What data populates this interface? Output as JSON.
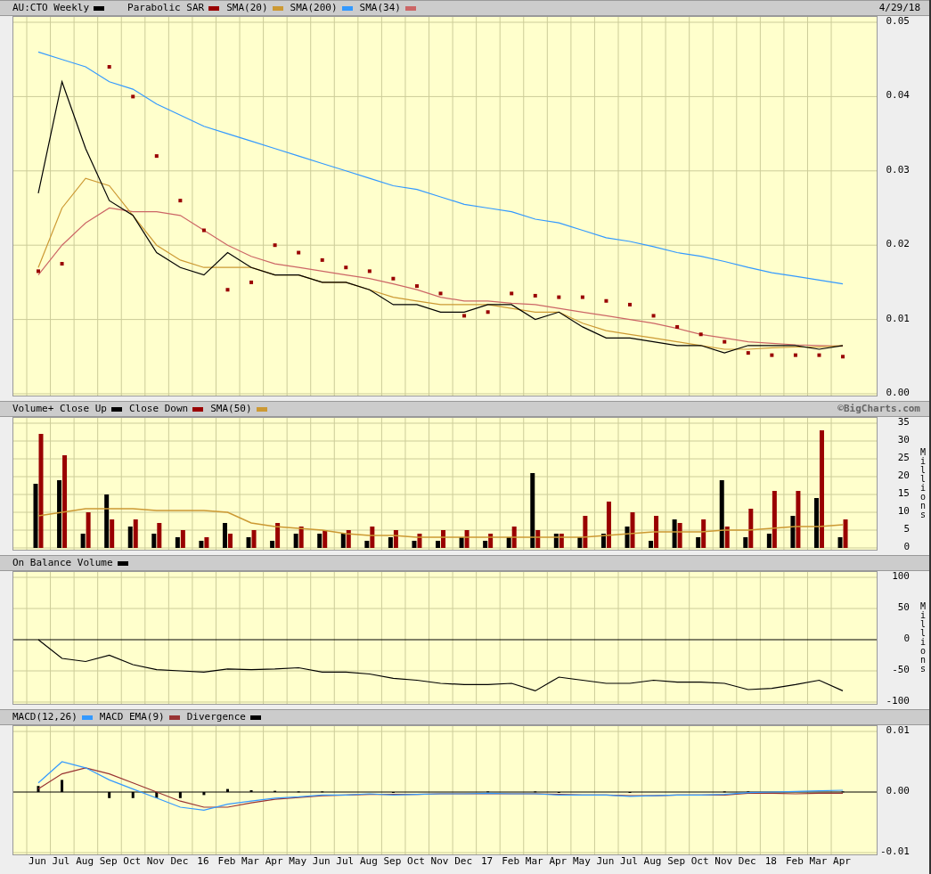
{
  "panels": [
    {
      "kind": "price",
      "date": "4/29/18",
      "chart_data": {
        "type": "line",
        "grid": true,
        "ylim": [
          0,
          0.05
        ],
        "yticks": [
          {
            "value": 0,
            "label": "0.00"
          },
          {
            "value": 0.01,
            "label": "0.01"
          },
          {
            "value": 0.02,
            "label": "0.02"
          },
          {
            "value": 0.03,
            "label": "0.03"
          },
          {
            "value": 0.04,
            "label": "0.04"
          },
          {
            "value": 0.05,
            "label": "0.05"
          }
        ],
        "series": [
          {
            "name": "AU:CTO Weekly",
            "type": "line",
            "color": "#000000",
            "values": [
              0.027,
              0.042,
              0.033,
              0.026,
              0.024,
              0.019,
              0.017,
              0.016,
              0.019,
              0.017,
              0.016,
              0.016,
              0.015,
              0.015,
              0.014,
              0.012,
              0.012,
              0.011,
              0.011,
              0.012,
              0.012,
              0.01,
              0.011,
              0.009,
              0.0075,
              0.0075,
              0.007,
              0.0065,
              0.0065,
              0.0055,
              0.0065,
              0.0065,
              0.0065,
              0.006,
              0.0065
            ]
          },
          {
            "name": "Parabolic SAR",
            "type": "scatter",
            "color": "#990000",
            "values": [
              0.0165,
              0.0175,
              null,
              0.044,
              0.04,
              0.032,
              0.026,
              0.022,
              0.014,
              0.015,
              0.02,
              0.019,
              0.018,
              0.017,
              0.0165,
              0.0155,
              0.0145,
              0.0135,
              0.0105,
              0.011,
              0.0135,
              0.0132,
              0.013,
              0.013,
              0.0125,
              0.012,
              0.0105,
              0.009,
              0.008,
              0.007,
              0.0055,
              0.0052,
              0.0052,
              0.0052,
              0.005
            ]
          },
          {
            "name": "SMA(20)",
            "type": "line",
            "color": "#cc9933",
            "values": [
              0.017,
              0.025,
              0.029,
              0.028,
              0.024,
              0.02,
              0.018,
              0.017,
              0.017,
              0.017,
              0.016,
              0.016,
              0.015,
              0.015,
              0.014,
              0.013,
              0.0125,
              0.012,
              0.012,
              0.012,
              0.0115,
              0.011,
              0.011,
              0.0095,
              0.0085,
              0.008,
              0.0075,
              0.007,
              0.0065,
              0.006,
              0.006,
              0.0062,
              0.0063,
              0.0063,
              0.0065
            ]
          },
          {
            "name": "SMA(200)",
            "type": "line",
            "color": "#3399ff",
            "values": [
              0.046,
              0.045,
              0.044,
              0.042,
              0.041,
              0.039,
              0.0375,
              0.036,
              0.035,
              0.034,
              0.033,
              0.032,
              0.031,
              0.03,
              0.029,
              0.028,
              0.0275,
              0.0265,
              0.0255,
              0.025,
              0.0245,
              0.0235,
              0.023,
              0.022,
              0.021,
              0.0205,
              0.0198,
              0.019,
              0.0185,
              0.0178,
              0.017,
              0.0163,
              0.0158,
              0.0153,
              0.0148
            ]
          },
          {
            "name": "SMA(34)",
            "type": "line",
            "color": "#cc6666",
            "values": [
              0.016,
              0.02,
              0.023,
              0.025,
              0.0245,
              0.0245,
              0.024,
              0.022,
              0.02,
              0.0185,
              0.0175,
              0.017,
              0.0165,
              0.016,
              0.0155,
              0.0148,
              0.014,
              0.013,
              0.0125,
              0.0125,
              0.0122,
              0.012,
              0.0115,
              0.011,
              0.0105,
              0.01,
              0.0095,
              0.0088,
              0.008,
              0.0075,
              0.007,
              0.0068,
              0.0066,
              0.0065,
              0.0064
            ]
          }
        ]
      }
    },
    {
      "kind": "volume",
      "credit": "©BigCharts.com",
      "chart_data": {
        "type": "bar",
        "grid": true,
        "ylabel": "Millions",
        "ylim": [
          0,
          35
        ],
        "yticks": [
          0,
          5,
          10,
          15,
          20,
          25,
          30,
          35
        ],
        "series": [
          {
            "name": "Volume+ Close Up",
            "type": "bar",
            "color": "#000000",
            "values": [
              18,
              19,
              4,
              15,
              6,
              4,
              3,
              2,
              7,
              3,
              2,
              4,
              4,
              4,
              2,
              3,
              2,
              2,
              3,
              2,
              3,
              21,
              4,
              3,
              4,
              6,
              2,
              8,
              3,
              19,
              3,
              4,
              9,
              14,
              3
            ]
          },
          {
            "name": "Close Down",
            "type": "bar",
            "color": "#990000",
            "values": [
              32,
              26,
              10,
              8,
              8,
              7,
              5,
              3,
              4,
              5,
              7,
              6,
              5,
              5,
              6,
              5,
              4,
              5,
              5,
              4,
              6,
              5,
              4,
              9,
              13,
              10,
              9,
              7,
              8,
              6,
              11,
              16,
              16,
              33,
              8
            ]
          },
          {
            "name": "SMA(50)",
            "type": "line",
            "color": "#cc9933",
            "values": [
              9,
              10,
              11,
              11,
              11,
              10.5,
              10.5,
              10.5,
              10,
              7,
              6,
              5.5,
              5,
              4,
              3.5,
              3.5,
              3,
              3,
              3,
              3,
              3,
              3,
              3,
              3,
              3.5,
              4,
              4.5,
              4.5,
              4.5,
              5,
              5,
              5.5,
              6,
              6,
              6.5
            ]
          }
        ]
      }
    },
    {
      "kind": "obv",
      "chart_data": {
        "type": "line",
        "grid": true,
        "ylabel": "Millions",
        "ylim": [
          -100,
          100
        ],
        "yticks": [
          -100,
          -50,
          0,
          50,
          100
        ],
        "series": [
          {
            "name": "On Balance Volume",
            "type": "line",
            "color": "#000000",
            "values": [
              0,
              -30,
              -35,
              -25,
              -40,
              -48,
              -50,
              -52,
              -47,
              -48,
              -47,
              -45,
              -52,
              -52,
              -55,
              -62,
              -65,
              -70,
              -72,
              -72,
              -70,
              -82,
              -60,
              -65,
              -70,
              -70,
              -65,
              -68,
              -68,
              -70,
              -80,
              -78,
              -72,
              -65,
              -82
            ]
          }
        ]
      }
    },
    {
      "kind": "macd",
      "chart_data": {
        "type": "line",
        "grid": true,
        "categories": [
          "Jun",
          "Jul",
          "Aug",
          "Sep",
          "Oct",
          "Nov",
          "Dec",
          "16",
          "Feb",
          "Mar",
          "Apr",
          "May",
          "Jun",
          "Jul",
          "Aug",
          "Sep",
          "Oct",
          "Nov",
          "Dec",
          "17",
          "Feb",
          "Mar",
          "Apr",
          "May",
          "Jun",
          "Jul",
          "Aug",
          "Sep",
          "Oct",
          "Nov",
          "Dec",
          "18",
          "Feb",
          "Mar",
          "Apr"
        ],
        "ylim": [
          -0.01,
          0.01
        ],
        "yticks": [
          {
            "value": -0.01,
            "label": "-0.01"
          },
          {
            "value": 0,
            "label": "0.00"
          },
          {
            "value": 0.01,
            "label": "0.01"
          }
        ],
        "series": [
          {
            "name": "MACD(12,26)",
            "type": "line",
            "color": "#3399ff",
            "values": [
              0.0015,
              0.005,
              0.004,
              0.002,
              0.0005,
              -0.001,
              -0.0025,
              -0.003,
              -0.002,
              -0.0015,
              -0.001,
              -0.0008,
              -0.0005,
              -0.0005,
              -0.0003,
              -0.0005,
              -0.0004,
              -0.0003,
              -0.0003,
              -0.0002,
              -0.0003,
              -0.0003,
              -0.0005,
              -0.0005,
              -0.0005,
              -0.0007,
              -0.0006,
              -0.0005,
              -0.0005,
              -0.0004,
              -0.0001,
              0,
              0.0001,
              0.0002,
              0.0003
            ]
          },
          {
            "name": "MACD EMA(9)",
            "type": "line",
            "color": "#993333",
            "values": [
              0.0005,
              0.003,
              0.004,
              0.003,
              0.0015,
              0,
              -0.0015,
              -0.0025,
              -0.0025,
              -0.0018,
              -0.0012,
              -0.0009,
              -0.0006,
              -0.0005,
              -0.0004,
              -0.0004,
              -0.0004,
              -0.0003,
              -0.0003,
              -0.0003,
              -0.0003,
              -0.0003,
              -0.0004,
              -0.0005,
              -0.0005,
              -0.0006,
              -0.0006,
              -0.0005,
              -0.0005,
              -0.0005,
              -0.0002,
              -0.0002,
              -0.0003,
              -0.0002,
              -0.0002
            ]
          },
          {
            "name": "Divergence",
            "type": "bar",
            "color": "#000000",
            "values": [
              0.001,
              0.002,
              null,
              -0.001,
              -0.001,
              -0.001,
              -0.001,
              -0.0005,
              0.0005,
              0.0003,
              0.0002,
              0.0001,
              0.0001,
              null,
              null,
              -0.0001,
              null,
              null,
              null,
              0.0001,
              null,
              0.0001,
              -0.0001,
              null,
              null,
              -0.0001,
              null,
              null,
              null,
              0.0001,
              0.0001,
              null,
              null,
              null,
              0.0001
            ]
          }
        ]
      }
    }
  ]
}
